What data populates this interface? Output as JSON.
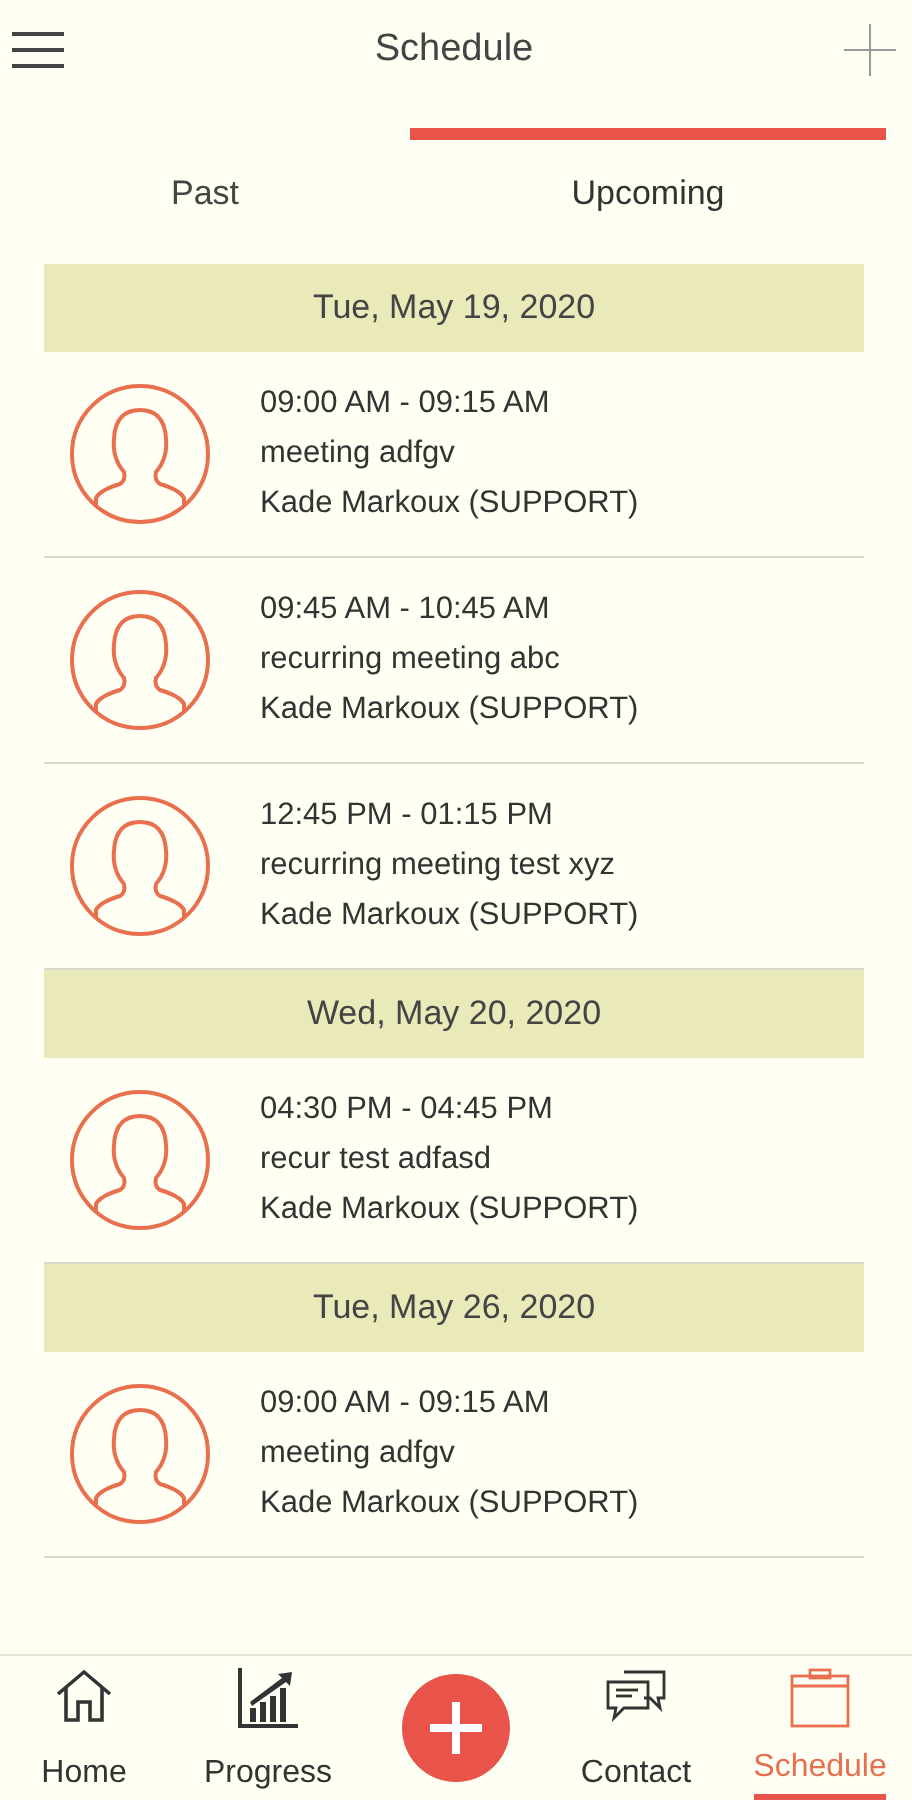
{
  "header": {
    "title": "Schedule"
  },
  "tabs": [
    {
      "label": "Past",
      "selected": false
    },
    {
      "label": "Upcoming",
      "selected": true
    }
  ],
  "sections": [
    {
      "date": "Tue, May 19, 2020",
      "events": [
        {
          "time": "09:00 AM - 09:15 AM",
          "title": "meeting adfgv",
          "person": "Kade Markoux (SUPPORT)"
        },
        {
          "time": "09:45 AM - 10:45 AM",
          "title": "recurring meeting abc",
          "person": "Kade Markoux (SUPPORT)"
        },
        {
          "time": "12:45 PM - 01:15 PM",
          "title": "recurring meeting test xyz",
          "person": "Kade Markoux (SUPPORT)"
        }
      ]
    },
    {
      "date": "Wed, May 20, 2020",
      "events": [
        {
          "time": "04:30 PM - 04:45 PM",
          "title": "recur test adfasd",
          "person": "Kade Markoux (SUPPORT)"
        }
      ]
    },
    {
      "date": "Tue, May 26, 2020",
      "events": [
        {
          "time": "09:00 AM - 09:15 AM",
          "title": "meeting adfgv",
          "person": "Kade Markoux (SUPPORT)"
        }
      ]
    }
  ],
  "bottom_nav": [
    {
      "kind": "home",
      "label": "Home",
      "selected": false
    },
    {
      "kind": "chart",
      "label": "Progress",
      "selected": false
    },
    {
      "kind": "add",
      "selected": false
    },
    {
      "kind": "chat",
      "label": "Contact",
      "selected": false
    },
    {
      "kind": "calendar",
      "label": "Schedule",
      "selected": true
    }
  ]
}
